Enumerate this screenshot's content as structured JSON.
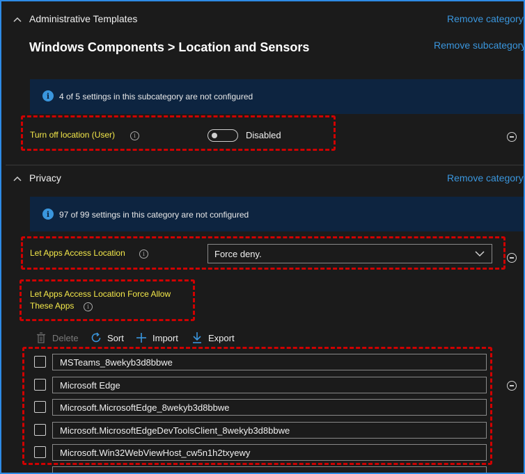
{
  "section1": {
    "title": "Administrative Templates",
    "remove_category": "Remove category",
    "subtitle": "Windows Components > Location and Sensors",
    "remove_subcategory": "Remove subcategory",
    "info": "4 of 5 settings in this subcategory are not configured",
    "setting": {
      "label": "Turn off location (User)",
      "state": "Disabled",
      "enabled": false
    }
  },
  "section2": {
    "title": "Privacy",
    "remove_category": "Remove category",
    "info": "97 of 99 settings in this category are not configured",
    "location_setting": {
      "label": "Let Apps Access Location",
      "value": "Force deny."
    },
    "force_allow": {
      "label_line1": "Let Apps Access Location Force Allow",
      "label_line2": "These Apps"
    },
    "toolbar": {
      "delete": "Delete",
      "sort": "Sort",
      "import": "Import",
      "export": "Export"
    },
    "apps": [
      "MSTeams_8wekyb3d8bbwe",
      "Microsoft Edge",
      "Microsoft.MicrosoftEdge_8wekyb3d8bbwe",
      "Microsoft.MicrosoftEdgeDevToolsClient_8wekyb3d8bbwe",
      "Microsoft.Win32WebViewHost_cw5n1h2txyewy"
    ]
  },
  "colors": {
    "accent": "#3a96dd",
    "highlight_label": "#f5e94a",
    "annotation": "#d00000",
    "info_bar": "#0d2440"
  }
}
